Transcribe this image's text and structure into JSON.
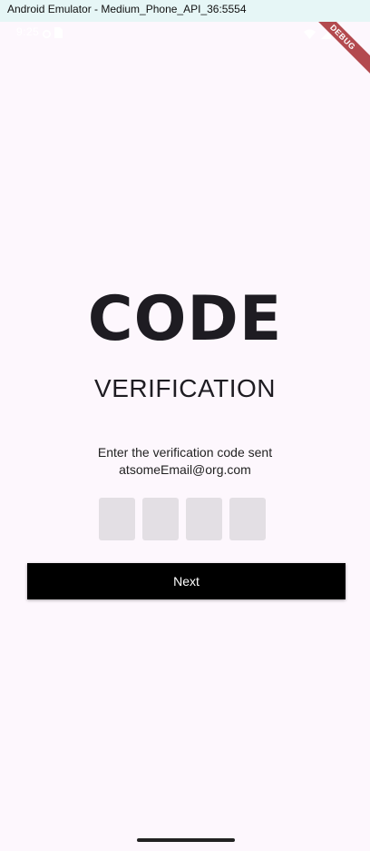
{
  "window": {
    "title": "Android Emulator - Medium_Phone_API_36:5554"
  },
  "status_bar": {
    "time": "9:25",
    "icons_left": [
      "settings-icon",
      "sim-icon"
    ],
    "icons_right": [
      "wifi-icon",
      "signal-icon",
      "battery-icon"
    ]
  },
  "debug_banner": {
    "label": "DEBUG",
    "color": "#b34a4f"
  },
  "main": {
    "title": "CODE",
    "subtitle": "VERIFICATION",
    "instruction_line1": "Enter the verification code sent",
    "instruction_line2": "atsomeEmail@org.com",
    "otp_digits": [
      "",
      "",
      "",
      ""
    ],
    "next_label": "Next"
  },
  "colors": {
    "background": "#fdf7fd",
    "otp_box": "#e3dfe4",
    "button": "#000000",
    "text": "#1e1c22"
  }
}
